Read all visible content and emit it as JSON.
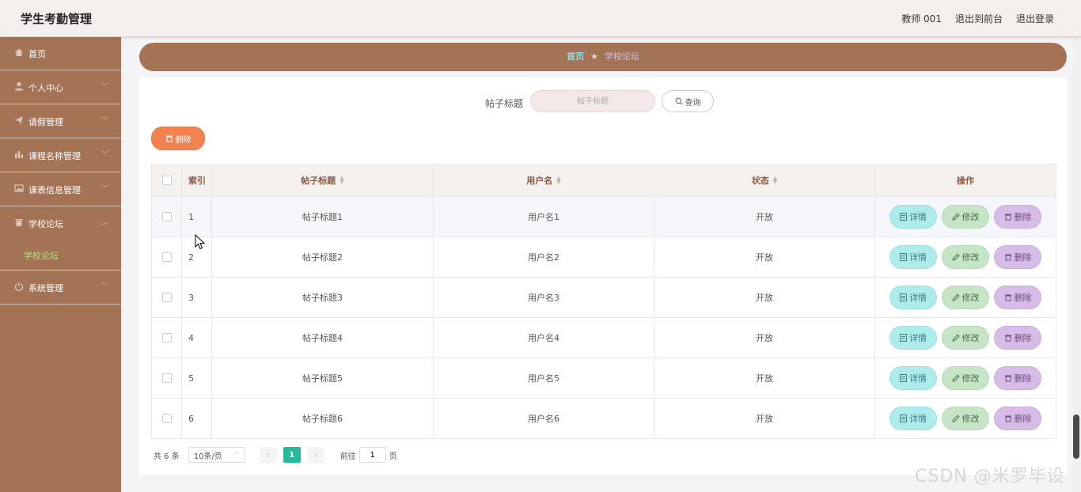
{
  "header": {
    "title": "学生考勤管理",
    "links": [
      "教师 001",
      "退出到前台",
      "退出登录"
    ]
  },
  "sidebar": {
    "items": [
      {
        "label": "首页",
        "icon": "home-icon"
      },
      {
        "label": "个人中心",
        "icon": "user-icon"
      },
      {
        "label": "请假管理",
        "icon": "send-icon"
      },
      {
        "label": "课程名称管理",
        "icon": "bar-chart-icon"
      },
      {
        "label": "课表信息管理",
        "icon": "image-icon"
      },
      {
        "label": "学校论坛",
        "icon": "trash-icon"
      }
    ],
    "sub_active": "学校论坛",
    "last_item": {
      "label": "系统管理",
      "icon": "power-icon"
    }
  },
  "breadcrumb": {
    "home": "首页",
    "separator": "★",
    "current": "学校论坛"
  },
  "search": {
    "label": "帖子标题",
    "placeholder": "帖子标题",
    "button": "查询"
  },
  "toolbar": {
    "delete_label": "删除"
  },
  "table": {
    "headers": {
      "index": "索引",
      "title": "帖子标题",
      "user": "用户名",
      "status": "状态",
      "ops": "操作"
    },
    "rows": [
      {
        "index": "1",
        "title": "帖子标题1",
        "user": "用户名1",
        "status": "开放"
      },
      {
        "index": "2",
        "title": "帖子标题2",
        "user": "用户名2",
        "status": "开放"
      },
      {
        "index": "3",
        "title": "帖子标题3",
        "user": "用户名3",
        "status": "开放"
      },
      {
        "index": "4",
        "title": "帖子标题4",
        "user": "用户名4",
        "status": "开放"
      },
      {
        "index": "5",
        "title": "帖子标题5",
        "user": "用户名5",
        "status": "开放"
      },
      {
        "index": "6",
        "title": "帖子标题6",
        "user": "用户名6",
        "status": "开放"
      }
    ],
    "actions": {
      "detail": "详情",
      "edit": "修改",
      "delete": "删除"
    }
  },
  "pagination": {
    "total": "共 6 条",
    "page_size": "10条/页",
    "current_page": "1",
    "goto_label": "前往",
    "goto_value": "1",
    "page_suffix": "页"
  },
  "watermark": "CSDN @米罗毕设",
  "colors": {
    "sidebar_bg": "#a47356",
    "accent_delete": "#f2824f",
    "page_active": "#26b99a",
    "detail_btn": "#aeeceb",
    "edit_btn": "#c5e5c6",
    "delete_btn": "#d6bce6"
  }
}
